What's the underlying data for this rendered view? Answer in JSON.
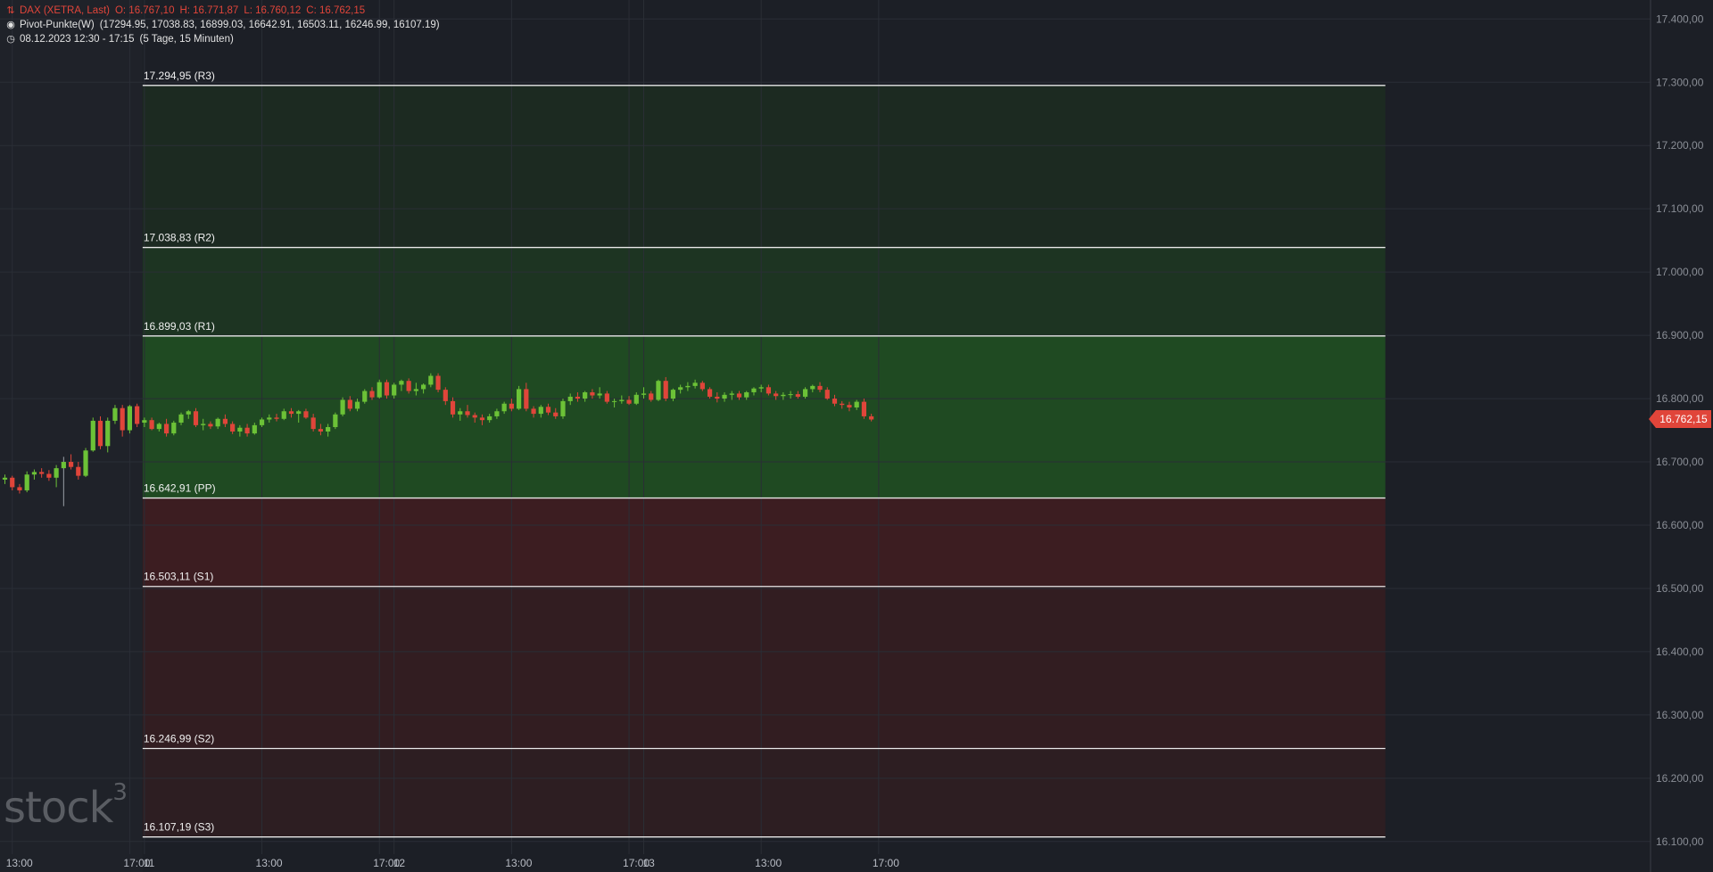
{
  "legend": {
    "instrument": "DAX (XETRA, Last)",
    "open": "O: 16.767,10",
    "high": "H: 16.771,87",
    "low": "L: 16.760,12",
    "close": "C: 16.762,15",
    "indicator": "Pivot-Punkte(W)",
    "indicator_values": "(17294.95,  17038.83,  16899.03,  16642.91,  16503.11,  16246.99,  16107.19)",
    "date_range": "08.12.2023 12:30 - 17:15",
    "range_info": "(5 Tage, 15 Minuten)"
  },
  "current_price": "16.762,15",
  "watermark": {
    "text": "stock",
    "sup": "3"
  },
  "colors": {
    "background": "#1c1f26",
    "up": "#6cc237",
    "down": "#e0453a",
    "resistance_zone": "#1f4a22",
    "support_zone": "#4a2024",
    "pivot_line": "#e8e8e8"
  },
  "chart_data": {
    "type": "candlestick",
    "title": "DAX (XETRA, Last)",
    "ylim": [
      16080,
      17430
    ],
    "y_ticks": [
      {
        "v": 17400,
        "label": "17.400,00"
      },
      {
        "v": 17300,
        "label": "17.300,00"
      },
      {
        "v": 17200,
        "label": "17.200,00"
      },
      {
        "v": 17100,
        "label": "17.100,00"
      },
      {
        "v": 17000,
        "label": "17.000,00"
      },
      {
        "v": 16900,
        "label": "16.900,00"
      },
      {
        "v": 16800,
        "label": "16.800,00"
      },
      {
        "v": 16700,
        "label": "16.700,00"
      },
      {
        "v": 16600,
        "label": "16.600,00"
      },
      {
        "v": 16500,
        "label": "16.500,00"
      },
      {
        "v": 16400,
        "label": "16.400,00"
      },
      {
        "v": 16300,
        "label": "16.300,00"
      },
      {
        "v": 16200,
        "label": "16.200,00"
      },
      {
        "v": 16100,
        "label": "16.100,00"
      }
    ],
    "x_ticks": [
      {
        "bar": 1,
        "label": "13:00"
      },
      {
        "bar": 17,
        "label": "17:00"
      },
      {
        "bar": 19,
        "label": "11"
      },
      {
        "bar": 35,
        "label": "13:00"
      },
      {
        "bar": 51,
        "label": "17:00"
      },
      {
        "bar": 53,
        "label": "12"
      },
      {
        "bar": 69,
        "label": "13:00"
      },
      {
        "bar": 85,
        "label": "17:00"
      },
      {
        "bar": 87,
        "label": "13"
      },
      {
        "bar": 103,
        "label": "13:00"
      },
      {
        "bar": 119,
        "label": "17:00"
      }
    ],
    "pivot_start_bar": 19,
    "pivot_end_bar": 188,
    "pivot_levels": [
      {
        "name": "R3",
        "value": 17294.95,
        "label": "17.294,95 (R3)"
      },
      {
        "name": "R2",
        "value": 17038.83,
        "label": "17.038,83 (R2)"
      },
      {
        "name": "R1",
        "value": 16899.03,
        "label": "16.899,03 (R1)"
      },
      {
        "name": "PP",
        "value": 16642.91,
        "label": "16.642,91 (PP)"
      },
      {
        "name": "S1",
        "value": 16503.11,
        "label": "16.503,11 (S1)"
      },
      {
        "name": "S2",
        "value": 16246.99,
        "label": "16.246,99 (S2)"
      },
      {
        "name": "S3",
        "value": 16107.19,
        "label": "16.107,19 (S3)"
      }
    ],
    "candles": [
      [
        16672,
        16680,
        16665,
        16675
      ],
      [
        16675,
        16678,
        16655,
        16660
      ],
      [
        16660,
        16665,
        16650,
        16655
      ],
      [
        16655,
        16685,
        16652,
        16680
      ],
      [
        16680,
        16688,
        16672,
        16684
      ],
      [
        16684,
        16690,
        16675,
        16681
      ],
      [
        16681,
        16687,
        16670,
        16675
      ],
      [
        16675,
        16695,
        16660,
        16690
      ],
      [
        16690,
        16708,
        16630,
        16700
      ],
      [
        16700,
        16712,
        16688,
        16692
      ],
      [
        16692,
        16700,
        16672,
        16678
      ],
      [
        16678,
        16722,
        16676,
        16718
      ],
      [
        16718,
        16770,
        16716,
        16765
      ],
      [
        16765,
        16772,
        16720,
        16725
      ],
      [
        16725,
        16770,
        16715,
        16765
      ],
      [
        16765,
        16790,
        16760,
        16785
      ],
      [
        16785,
        16790,
        16740,
        16750
      ],
      [
        16750,
        16790,
        16745,
        16788
      ],
      [
        16788,
        16792,
        16755,
        16760
      ],
      [
        16762,
        16770,
        16755,
        16766
      ],
      [
        16766,
        16770,
        16750,
        16752
      ],
      [
        16752,
        16762,
        16748,
        16760
      ],
      [
        16760,
        16768,
        16740,
        16745
      ],
      [
        16745,
        16765,
        16742,
        16762
      ],
      [
        16762,
        16778,
        16758,
        16775
      ],
      [
        16775,
        16782,
        16768,
        16780
      ],
      [
        16780,
        16785,
        16755,
        16758
      ],
      [
        16758,
        16768,
        16750,
        16760
      ],
      [
        16760,
        16764,
        16752,
        16756
      ],
      [
        16756,
        16770,
        16752,
        16768
      ],
      [
        16768,
        16775,
        16755,
        16760
      ],
      [
        16760,
        16764,
        16744,
        16748
      ],
      [
        16748,
        16758,
        16740,
        16754
      ],
      [
        16754,
        16760,
        16740,
        16745
      ],
      [
        16745,
        16762,
        16743,
        16758
      ],
      [
        16758,
        16770,
        16755,
        16767
      ],
      [
        16767,
        16775,
        16762,
        16770
      ],
      [
        16770,
        16776,
        16764,
        16768
      ],
      [
        16768,
        16784,
        16766,
        16780
      ],
      [
        16780,
        16785,
        16770,
        16776
      ],
      [
        16776,
        16782,
        16762,
        16780
      ],
      [
        16780,
        16784,
        16768,
        16770
      ],
      [
        16770,
        16776,
        16748,
        16752
      ],
      [
        16752,
        16760,
        16742,
        16748
      ],
      [
        16748,
        16760,
        16740,
        16755
      ],
      [
        16755,
        16778,
        16752,
        16775
      ],
      [
        16775,
        16802,
        16772,
        16798
      ],
      [
        16798,
        16804,
        16780,
        16784
      ],
      [
        16784,
        16800,
        16780,
        16795
      ],
      [
        16795,
        16815,
        16792,
        16812
      ],
      [
        16812,
        16818,
        16798,
        16802
      ],
      [
        16802,
        16830,
        16800,
        16826
      ],
      [
        16826,
        16830,
        16800,
        16805
      ],
      [
        16805,
        16825,
        16800,
        16822
      ],
      [
        16822,
        16830,
        16812,
        16828
      ],
      [
        16828,
        16832,
        16808,
        16812
      ],
      [
        16812,
        16825,
        16805,
        16815
      ],
      [
        16815,
        16824,
        16808,
        16822
      ],
      [
        16822,
        16840,
        16818,
        16836
      ],
      [
        16836,
        16840,
        16810,
        16814
      ],
      [
        16814,
        16818,
        16790,
        16796
      ],
      [
        16796,
        16802,
        16770,
        16775
      ],
      [
        16775,
        16785,
        16765,
        16780
      ],
      [
        16780,
        16790,
        16770,
        16774
      ],
      [
        16774,
        16778,
        16762,
        16770
      ],
      [
        16770,
        16775,
        16758,
        16766
      ],
      [
        16766,
        16776,
        16762,
        16772
      ],
      [
        16772,
        16784,
        16768,
        16780
      ],
      [
        16780,
        16795,
        16776,
        16792
      ],
      [
        16792,
        16800,
        16780,
        16784
      ],
      [
        16784,
        16820,
        16782,
        16815
      ],
      [
        16815,
        16825,
        16780,
        16784
      ],
      [
        16784,
        16788,
        16770,
        16776
      ],
      [
        16776,
        16790,
        16770,
        16787
      ],
      [
        16787,
        16792,
        16774,
        16778
      ],
      [
        16778,
        16785,
        16768,
        16772
      ],
      [
        16772,
        16800,
        16768,
        16796
      ],
      [
        16796,
        16808,
        16790,
        16803
      ],
      [
        16803,
        16810,
        16795,
        16800
      ],
      [
        16800,
        16812,
        16795,
        16810
      ],
      [
        16810,
        16815,
        16800,
        16805
      ],
      [
        16805,
        16818,
        16800,
        16808
      ],
      [
        16808,
        16812,
        16792,
        16795
      ],
      [
        16795,
        16800,
        16786,
        16796
      ],
      [
        16796,
        16805,
        16792,
        16798
      ],
      [
        16798,
        16804,
        16790,
        16792
      ],
      [
        16792,
        16810,
        16790,
        16806
      ],
      [
        16806,
        16818,
        16800,
        16808
      ],
      [
        16808,
        16812,
        16795,
        16798
      ],
      [
        16798,
        16830,
        16796,
        16828
      ],
      [
        16828,
        16834,
        16796,
        16800
      ],
      [
        16800,
        16816,
        16796,
        16814
      ],
      [
        16814,
        16822,
        16808,
        16818
      ],
      [
        16818,
        16826,
        16812,
        16820
      ],
      [
        16820,
        16830,
        16816,
        16825
      ],
      [
        16825,
        16828,
        16812,
        16815
      ],
      [
        16815,
        16818,
        16800,
        16803
      ],
      [
        16803,
        16810,
        16794,
        16800
      ],
      [
        16800,
        16810,
        16795,
        16806
      ],
      [
        16806,
        16812,
        16798,
        16808
      ],
      [
        16808,
        16812,
        16798,
        16802
      ],
      [
        16802,
        16812,
        16798,
        16810
      ],
      [
        16810,
        16818,
        16805,
        16816
      ],
      [
        16816,
        16822,
        16810,
        16818
      ],
      [
        16818,
        16822,
        16805,
        16808
      ],
      [
        16808,
        16812,
        16798,
        16804
      ],
      [
        16804,
        16810,
        16798,
        16806
      ],
      [
        16806,
        16812,
        16800,
        16807
      ],
      [
        16807,
        16812,
        16800,
        16803
      ],
      [
        16803,
        16818,
        16800,
        16815
      ],
      [
        16815,
        16822,
        16810,
        16820
      ],
      [
        16820,
        16826,
        16810,
        16814
      ],
      [
        16814,
        16818,
        16798,
        16800
      ],
      [
        16800,
        16806,
        16788,
        16792
      ],
      [
        16792,
        16796,
        16784,
        16790
      ],
      [
        16790,
        16795,
        16780,
        16786
      ],
      [
        16786,
        16798,
        16782,
        16795
      ],
      [
        16795,
        16800,
        16768,
        16772
      ],
      [
        16772,
        16776,
        16764,
        16767
      ]
    ]
  }
}
